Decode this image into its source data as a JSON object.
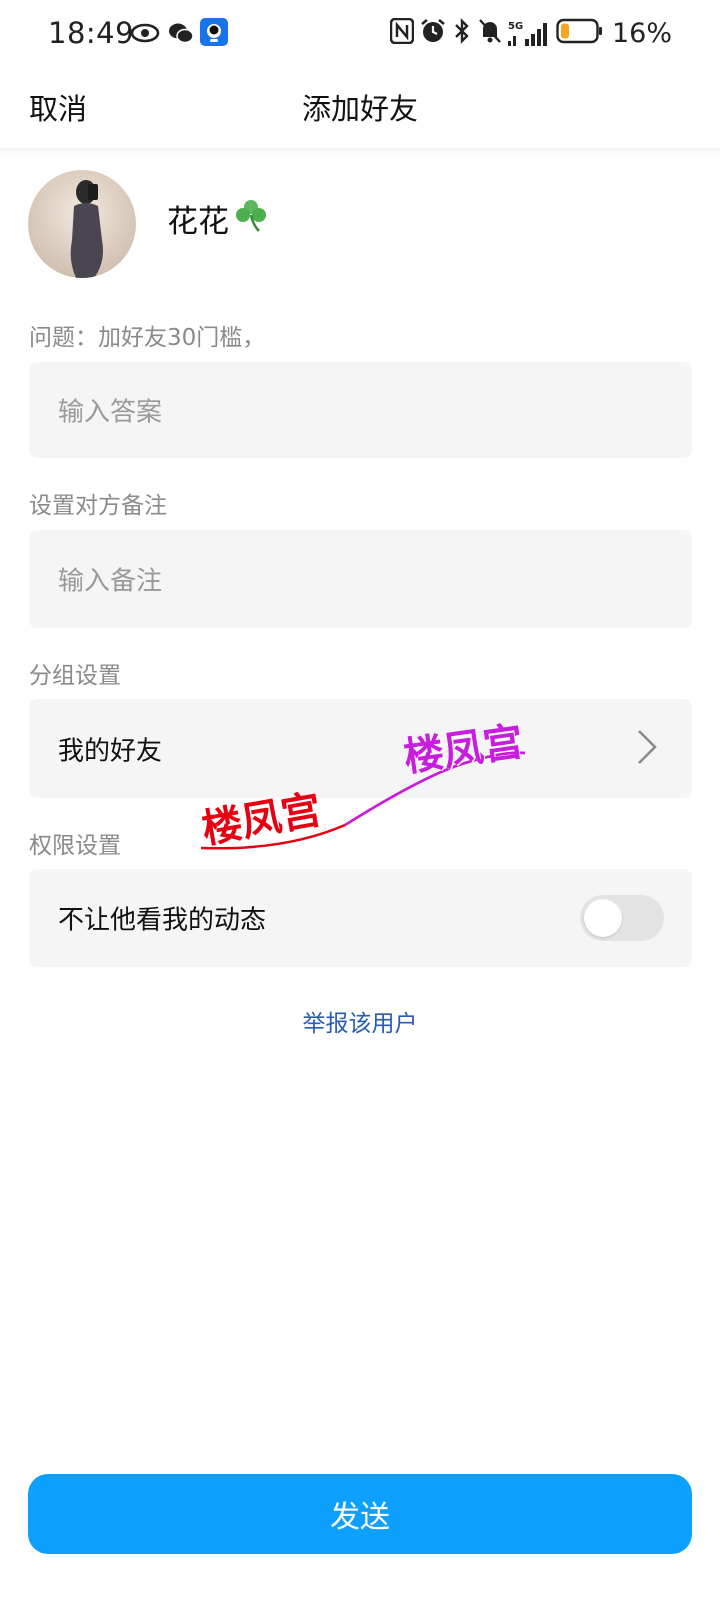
{
  "status_bar": {
    "time": "18:49",
    "battery_percent": "16%",
    "network": "5G",
    "icons": [
      "eye-icon",
      "wechat-icon",
      "app-icon",
      "nfc-icon",
      "alarm-icon",
      "bluetooth-icon",
      "mute-bell-icon",
      "signal-icon",
      "battery-icon"
    ]
  },
  "navbar": {
    "cancel_label": "取消",
    "title": "添加好友"
  },
  "profile": {
    "nickname": "花花",
    "nickname_emoji": "☘️"
  },
  "question": {
    "label": "问题：加好友30门槛，",
    "answer_placeholder": "输入答案"
  },
  "remark": {
    "label": "设置对方备注",
    "placeholder": "输入备注"
  },
  "group": {
    "label": "分组设置",
    "value": "我的好友"
  },
  "permission": {
    "label": "权限设置",
    "toggle_label": "不让他看我的动态",
    "toggle_on": false
  },
  "report_label": "举报该用户",
  "send_label": "发送",
  "watermark": {
    "text1": "楼凤宫",
    "text2": "楼凤宫"
  },
  "colors": {
    "primary": "#0ea0ff",
    "link": "#2a5db0",
    "field_bg": "#f5f5f5"
  }
}
